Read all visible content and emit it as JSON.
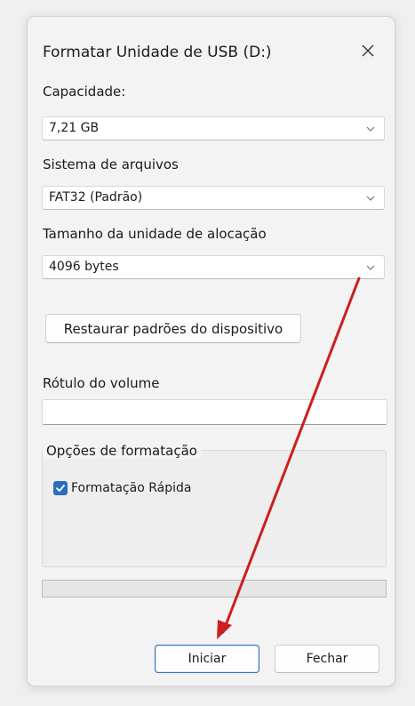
{
  "window": {
    "title": "Formatar Unidade de USB (D:)",
    "close_symbol": "✕"
  },
  "capacity": {
    "label": "Capacidade:",
    "value": "7,21 GB"
  },
  "file_system": {
    "label": "Sistema de arquivos",
    "value": "FAT32 (Padrão)"
  },
  "allocation": {
    "label": "Tamanho da unidade de alocação",
    "value": "4096 bytes"
  },
  "restore_button": {
    "label": "Restaurar padrões do dispositivo"
  },
  "volume_label": {
    "label": "Rótulo do volume",
    "value": ""
  },
  "format_options": {
    "legend": "Opções de formatação",
    "quick_format": {
      "label": "Formatação Rápida",
      "checked": true
    }
  },
  "progress": {
    "value": 0
  },
  "footer": {
    "start_label": "Iniciar",
    "close_label": "Fechar"
  },
  "colors": {
    "accent": "#2a6ebe",
    "annotation_arrow": "#cc1f1f"
  },
  "icons": {
    "close": "close-icon",
    "dropdown": "chevron-down-icon",
    "check": "checkmark-icon"
  }
}
